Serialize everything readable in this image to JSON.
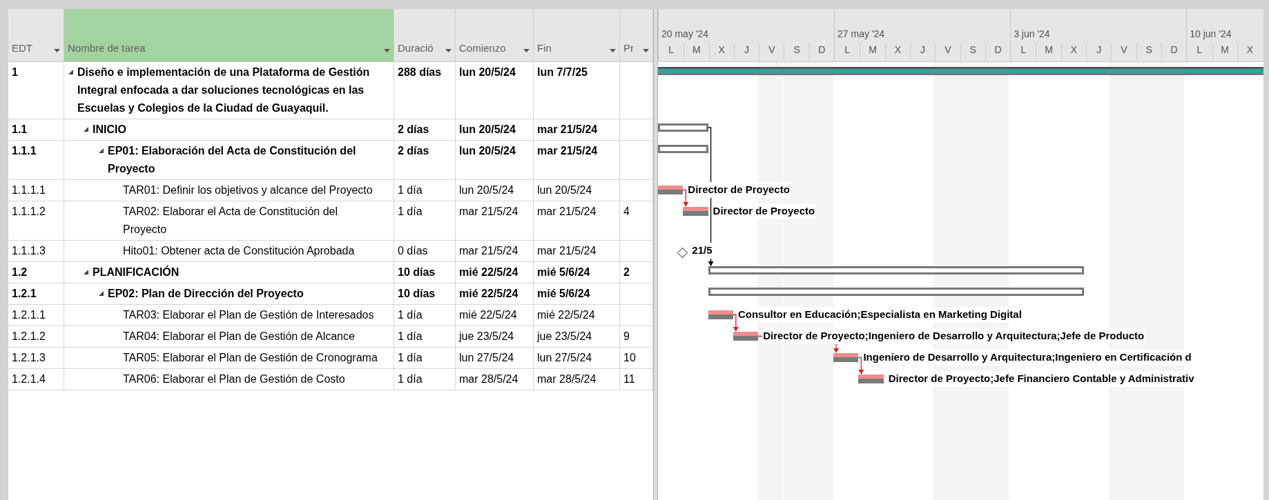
{
  "table": {
    "columns": [
      {
        "label": "EDT",
        "selected": false
      },
      {
        "label": "Nombre de tarea",
        "selected": true
      },
      {
        "label": "Duració",
        "selected": false
      },
      {
        "label": "Comienzo",
        "selected": false
      },
      {
        "label": "Fin",
        "selected": false
      },
      {
        "label": "Pr",
        "selected": false
      }
    ]
  },
  "timescale": {
    "weeks": [
      {
        "label": "20 may '24",
        "days": [
          "L",
          "M",
          "X",
          "J",
          "V",
          "S",
          "D"
        ]
      },
      {
        "label": "27 may '24",
        "days": [
          "L",
          "M",
          "X",
          "J",
          "V",
          "S",
          "D"
        ]
      },
      {
        "label": "3 jun '24",
        "days": [
          "L",
          "M",
          "X",
          "J",
          "V",
          "S",
          "D"
        ]
      },
      {
        "label": "10 jun '24",
        "days": [
          "L",
          "M",
          "X"
        ]
      }
    ]
  },
  "tasks": [
    {
      "kind": "project",
      "edt": "1",
      "name": "Diseño e implementación de una Plataforma de Gestión Integral enfocada a dar soluciones tecnológicas en las Escuelas y Colegios de la Ciudad de Guayaquil.",
      "duration": "288 días",
      "start": "lun 20/5/24",
      "finish": "lun 7/7/25",
      "expanded": true,
      "children": [
        {
          "kind": "summary",
          "edt": "1.1",
          "name": "INICIO",
          "duration": "2 días",
          "start": "lun 20/5/24",
          "finish": "mar 21/5/24",
          "expanded": true,
          "children": [
            {
              "kind": "summary",
              "edt": "1.1.1",
              "name": "EP01: Elaboración del Acta de Constitución del Proyecto",
              "duration": "2 días",
              "start": "lun 20/5/24",
              "finish": "mar 21/5/24",
              "expanded": true,
              "children": [
                {
                  "kind": "task",
                  "edt": "1.1.1.1",
                  "name": "TAR01: Definir los objetivos y alcance del Proyecto",
                  "duration": "1 día",
                  "start": "lun 20/5/24",
                  "finish": "lun 20/5/24",
                  "bar_label": "Director de Proyecto"
                },
                {
                  "kind": "task",
                  "edt": "1.1.1.2",
                  "name": "TAR02: Elaborar el Acta de Constitución del Proyecto",
                  "duration": "1 día",
                  "start": "mar 21/5/24",
                  "finish": "mar 21/5/24",
                  "predecessors": "4",
                  "bar_label": "Director de Proyecto"
                },
                {
                  "kind": "milestone",
                  "edt": "1.1.1.3",
                  "name": "Hito01: Obtener acta de Constitución Aprobada",
                  "duration": "0 días",
                  "start": "mar 21/5/24",
                  "finish": "mar 21/5/24",
                  "bar_label": "21/5"
                }
              ]
            }
          ]
        },
        {
          "kind": "summary",
          "edt": "1.2",
          "name": "PLANIFICACIÓN",
          "duration": "10 días",
          "start": "mié 22/5/24",
          "finish": "mié 5/6/24",
          "predecessors": "2",
          "expanded": true,
          "children": [
            {
              "kind": "summary",
              "edt": "1.2.1",
              "name": "EP02: Plan de Dirección del Proyecto",
              "duration": "10 días",
              "start": "mié 22/5/24",
              "finish": "mié 5/6/24",
              "expanded": true,
              "children": [
                {
                  "kind": "task",
                  "edt": "1.2.1.1",
                  "name": "TAR03: Elaborar el Plan de Gestión de Interesados",
                  "duration": "1 día",
                  "start": "mié 22/5/24",
                  "finish": "mié 22/5/24",
                  "bar_label": "Consultor en Educación;Especialista en Marketing Digital"
                },
                {
                  "kind": "task",
                  "edt": "1.2.1.2",
                  "name": "TAR04: Elaborar el Plan de Gestión de Alcance",
                  "duration": "1 día",
                  "start": "jue 23/5/24",
                  "finish": "jue 23/5/24",
                  "predecessors": "9",
                  "bar_label": "Director de Proyecto;Ingeniero de Desarrollo y Arquitectura;Jefe de Producto"
                },
                {
                  "kind": "task",
                  "edt": "1.2.1.3",
                  "name": "TAR05: Elaborar el Plan de Gestión de Cronograma",
                  "duration": "1 día",
                  "start": "lun 27/5/24",
                  "finish": "lun 27/5/24",
                  "predecessors": "10",
                  "bar_label": "Ingeniero de Desarrollo y Arquitectura;Ingeniero en Certificación d"
                },
                {
                  "kind": "task",
                  "edt": "1.2.1.4",
                  "name": "TAR06: Elaborar el Plan de Gestión de Costo",
                  "duration": "1 día",
                  "start": "mar 28/5/24",
                  "finish": "mar 28/5/24",
                  "predecessors": "11",
                  "bar_label": "Director de Proyecto;Jefe Financiero Contable y Administrativ"
                }
              ]
            }
          ]
        }
      ]
    }
  ]
}
